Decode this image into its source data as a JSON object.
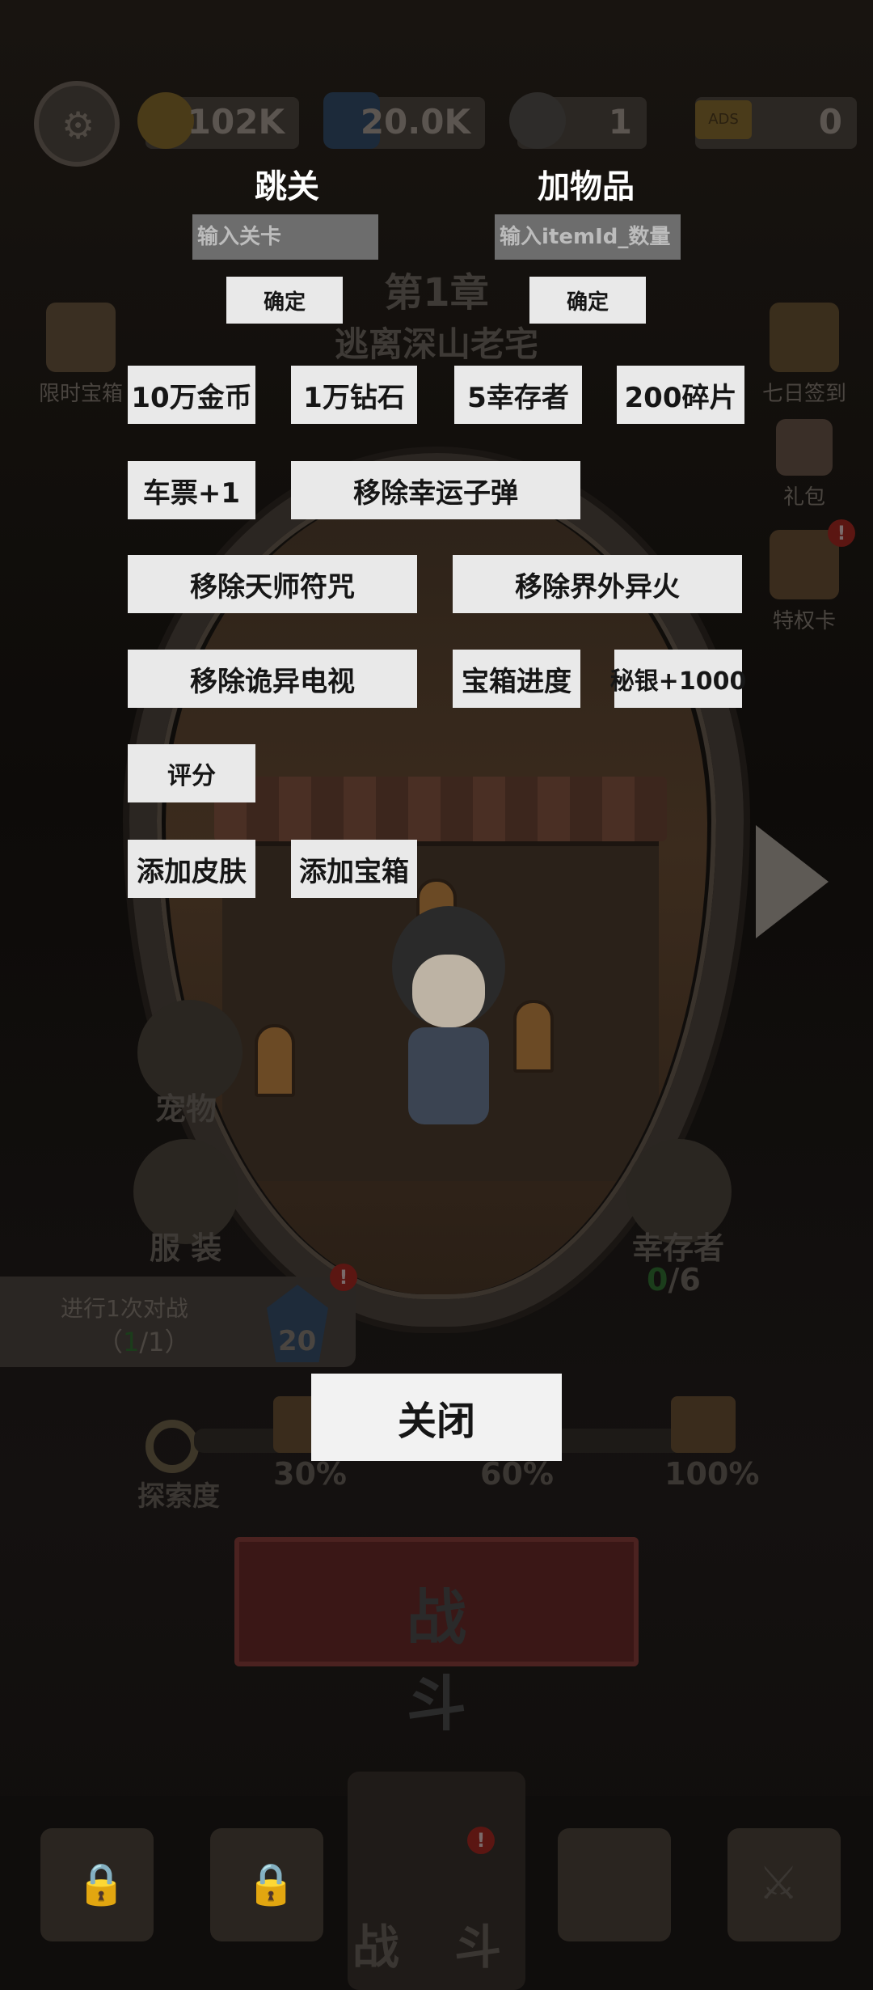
{
  "resources": {
    "gold": "102K",
    "diamond": "20.0K",
    "survivor_count": "1",
    "ads_label": "ADS",
    "ads_count": "0"
  },
  "chapter": {
    "number": "第1章",
    "name": "逃离深山老宅"
  },
  "side_left": {
    "limited_chest": "限时宝箱",
    "pet": "宠物",
    "outfit": "服 装"
  },
  "side_right": {
    "seven_day": "七日签到",
    "gift": "礼包",
    "privilege": "特权卡",
    "survivor": "幸存者",
    "survivor_count": "0",
    "survivor_total": "/6"
  },
  "task": {
    "text": "进行1次对战",
    "progress_open": "（",
    "progress_done": "1",
    "progress_rest": "/1）",
    "reward": "20"
  },
  "exploration": {
    "label": "探索度",
    "milestones": [
      "30%",
      "60%",
      "100%"
    ]
  },
  "battle_button": "战 斗",
  "tabbar": {
    "active_label": "战 斗"
  },
  "badge": "!",
  "debug": {
    "skip_level": {
      "title": "跳关",
      "placeholder": "输入关卡",
      "confirm": "确定"
    },
    "add_item": {
      "title": "加物品",
      "placeholder": "输入itemId_数量",
      "confirm": "确定"
    },
    "buttons": {
      "gold_100k": "10万金币",
      "diamond_10k": "1万钻石",
      "survivors_5": "5幸存者",
      "fragments_200": "200碎片",
      "ticket_plus1": "车票+1",
      "remove_lucky_bullet": "移除幸运子弹",
      "remove_taoist_talisman": "移除天师符咒",
      "remove_outer_fire": "移除界外异火",
      "remove_weird_tv": "移除诡异电视",
      "chest_progress": "宝箱进度",
      "mithril_plus1000": "秘银+1000",
      "rating": "评分",
      "add_skin": "添加皮肤",
      "add_chest": "添加宝箱"
    },
    "close": "关闭"
  }
}
